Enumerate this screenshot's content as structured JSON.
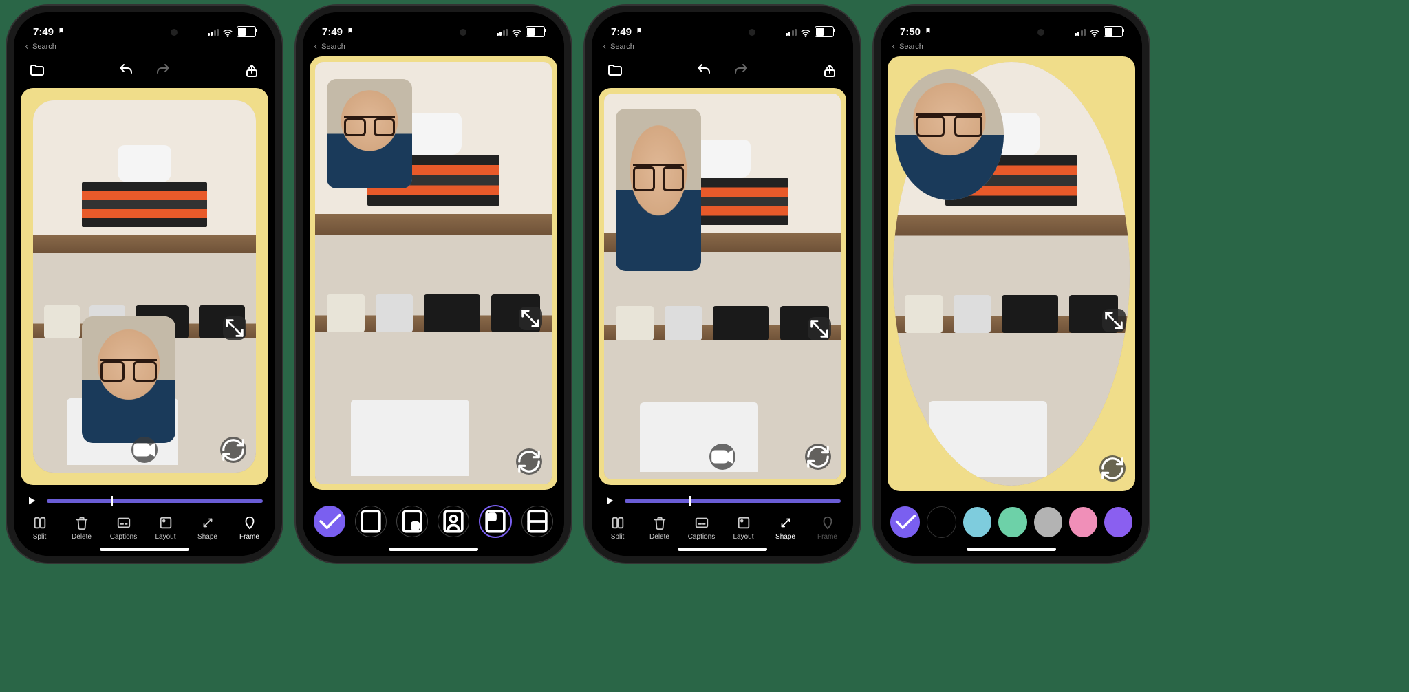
{
  "phones": [
    {
      "time": "7:49",
      "back_label": "Search",
      "canvas": {
        "frame_style": "padded-rounded",
        "pip": {
          "position": "lower-mid",
          "shape": "rounded-rect",
          "subject": "face"
        }
      },
      "overlay_buttons": {
        "expand": true,
        "camera": true,
        "switch": true
      },
      "timeline": true,
      "toolbar": {
        "type": "labeled",
        "items": [
          {
            "label": "Split",
            "icon": "split-icon",
            "active": false
          },
          {
            "label": "Delete",
            "icon": "trash-icon",
            "active": false
          },
          {
            "label": "Captions",
            "icon": "captions-icon",
            "active": false
          },
          {
            "label": "Layout",
            "icon": "layout-icon",
            "active": false
          },
          {
            "label": "Shape",
            "icon": "shape-icon",
            "active": false
          },
          {
            "label": "Frame",
            "icon": "frame-icon",
            "active": true
          }
        ]
      }
    },
    {
      "time": "7:49",
      "back_label": "Search",
      "canvas": {
        "frame_style": "full-rect",
        "pip": {
          "position": "top-left",
          "shape": "rounded-rect",
          "subject": "face"
        }
      },
      "overlay_buttons": {
        "expand": true,
        "switch": true
      },
      "timeline": false,
      "toolbar": {
        "type": "layout-picker",
        "confirm": true,
        "options": [
          {
            "name": "layout-full",
            "active": false
          },
          {
            "name": "layout-pip-br",
            "active": false
          },
          {
            "name": "layout-portrait",
            "active": false
          },
          {
            "name": "layout-pip-tl",
            "active": true
          },
          {
            "name": "layout-split",
            "active": false
          }
        ]
      }
    },
    {
      "time": "7:49",
      "back_label": "Search",
      "canvas": {
        "frame_style": "full-rect",
        "pip": {
          "position": "top-left-tall",
          "shape": "rounded-rect-tall",
          "subject": "face"
        }
      },
      "overlay_buttons": {
        "expand": true,
        "camera": true,
        "switch": true
      },
      "timeline": true,
      "toolbar": {
        "type": "labeled",
        "items": [
          {
            "label": "Split",
            "icon": "split-icon",
            "active": false
          },
          {
            "label": "Delete",
            "icon": "trash-icon",
            "active": false
          },
          {
            "label": "Captions",
            "icon": "captions-icon",
            "active": false
          },
          {
            "label": "Layout",
            "icon": "layout-icon",
            "active": false
          },
          {
            "label": "Shape",
            "icon": "shape-icon",
            "active": true
          },
          {
            "label": "Frame",
            "icon": "frame-icon",
            "active": false,
            "dim": true
          }
        ]
      }
    },
    {
      "time": "7:50",
      "back_label": "Search",
      "canvas": {
        "frame_style": "ellipse",
        "pip": {
          "position": "top-left",
          "shape": "circle",
          "subject": "face"
        }
      },
      "overlay_buttons": {
        "expand": true,
        "switch": true
      },
      "timeline": false,
      "toolbar": {
        "type": "color-picker",
        "confirm": true,
        "colors": [
          "#000000",
          "#7eccdd",
          "#6dd1a8",
          "#b3b3b3",
          "#f08fb8",
          "#8a5ff0"
        ]
      }
    }
  ]
}
